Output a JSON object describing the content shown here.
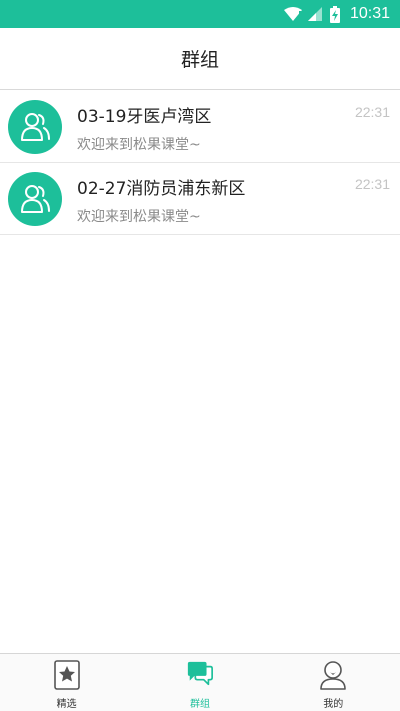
{
  "status_bar": {
    "time": "10:31"
  },
  "header": {
    "title": "群组"
  },
  "groups": [
    {
      "name": "03-19牙医卢湾区",
      "last_message": "欢迎来到松果课堂~",
      "time": "22:31"
    },
    {
      "name": "02-27消防员浦东新区",
      "last_message": "欢迎来到松果课堂~",
      "time": "22:31"
    }
  ],
  "tabs": [
    {
      "label": "精选",
      "icon": "star-icon",
      "active": false
    },
    {
      "label": "群组",
      "icon": "chat-bubbles-icon",
      "active": true
    },
    {
      "label": "我的",
      "icon": "profile-icon",
      "active": false
    }
  ],
  "colors": {
    "accent": "#1dbf9a",
    "inactive_icon": "#555555",
    "time_text": "#c4c4c4"
  }
}
